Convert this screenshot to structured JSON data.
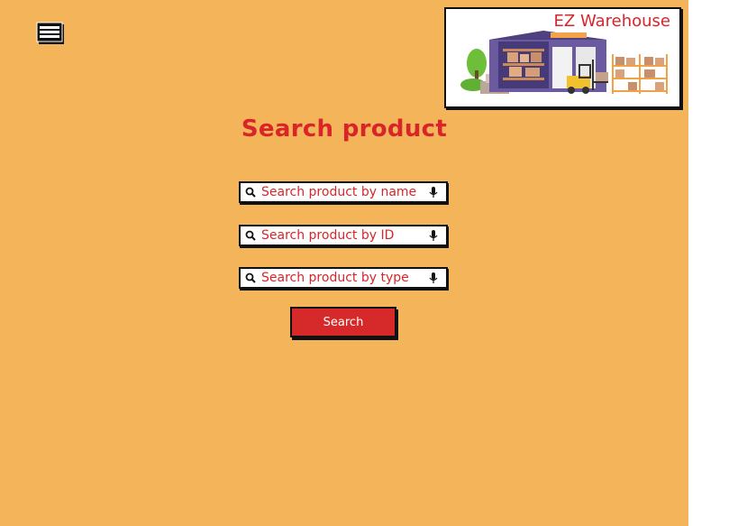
{
  "header": {
    "menu_icon": "hamburger-menu-icon",
    "logo_title": "EZ Warehouse"
  },
  "main": {
    "title": "Search product",
    "search_fields": [
      {
        "placeholder": "Search product by name"
      },
      {
        "placeholder": "Search product by ID"
      },
      {
        "placeholder": "Search product by type"
      }
    ],
    "search_button_label": "Search"
  },
  "colors": {
    "background": "#f4b55a",
    "accent": "#d9252a",
    "button": "#d62a2a"
  }
}
